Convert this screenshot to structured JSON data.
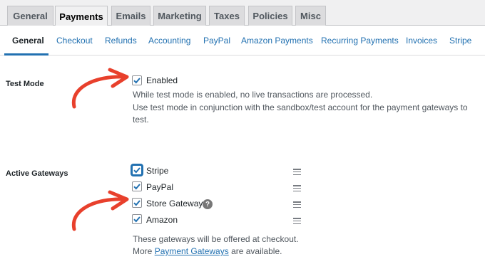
{
  "top_tabs": [
    "General",
    "Payments",
    "Emails",
    "Marketing",
    "Taxes",
    "Policies",
    "Misc"
  ],
  "active_top_tab": "Payments",
  "sub_tabs": [
    "General",
    "Checkout",
    "Refunds",
    "Accounting",
    "PayPal",
    "Amazon Payments",
    "Recurring Payments",
    "Invoices",
    "Stripe"
  ],
  "active_sub_tab": "General",
  "test_mode": {
    "label": "Test Mode",
    "checkbox_label": "Enabled",
    "checked": true,
    "desc_line1": "While test mode is enabled, no live transactions are processed.",
    "desc_line2": "Use test mode in conjunction with the sandbox/test account for the payment gateways to",
    "desc_line3": "test."
  },
  "active_gateways": {
    "label": "Active Gateways",
    "gateways": [
      {
        "name": "Stripe",
        "checked": true
      },
      {
        "name": "PayPal",
        "checked": true
      },
      {
        "name": "Store Gateway",
        "checked": true
      },
      {
        "name": "Amazon",
        "checked": true
      }
    ],
    "help_glyph": "?",
    "footer_line1": "These gateways will be offered at checkout.",
    "footer_prefix": "More ",
    "footer_link": "Payment Gateways",
    "footer_suffix": " are available."
  },
  "colors": {
    "accent": "#2271b1",
    "arrow": "#e8402c"
  },
  "icons": [
    "checkmark-icon",
    "help-icon",
    "drag-handle-icon",
    "red-arrow"
  ]
}
